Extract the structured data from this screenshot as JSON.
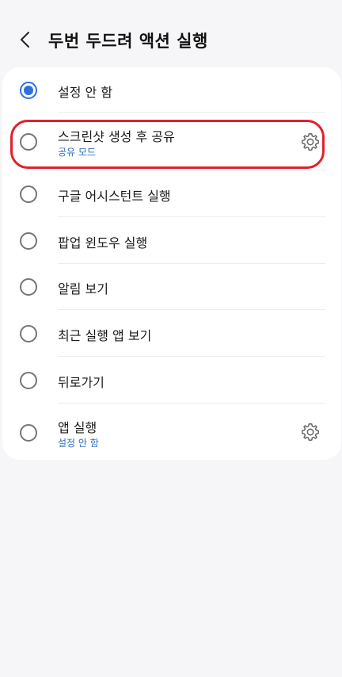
{
  "header": {
    "title": "두번 두드려 액션 실행",
    "back_icon": "back-arrow-icon"
  },
  "options": [
    {
      "label": "설정 안 함",
      "sublabel": "",
      "selected": true,
      "settings_icon": ""
    },
    {
      "label": "스크린샷 생성 후 공유",
      "sublabel": "공유 모드",
      "selected": false,
      "settings_icon": "gear-icon"
    },
    {
      "label": "구글 어시스턴트 실행",
      "sublabel": "",
      "selected": false,
      "settings_icon": ""
    },
    {
      "label": "팝업 윈도우 실행",
      "sublabel": "",
      "selected": false,
      "settings_icon": ""
    },
    {
      "label": "알림 보기",
      "sublabel": "",
      "selected": false,
      "settings_icon": ""
    },
    {
      "label": "최근 실행 앱 보기",
      "sublabel": "",
      "selected": false,
      "settings_icon": ""
    },
    {
      "label": "뒤로가기",
      "sublabel": "",
      "selected": false,
      "settings_icon": ""
    },
    {
      "label": "앱 실행",
      "sublabel": "설정 안 함",
      "selected": false,
      "settings_icon": "gear-icon"
    }
  ],
  "colors": {
    "accent": "#2f6fde",
    "sublabel": "#2f6fb8",
    "highlight": "#e2202e",
    "background": "#f6f6f8"
  }
}
